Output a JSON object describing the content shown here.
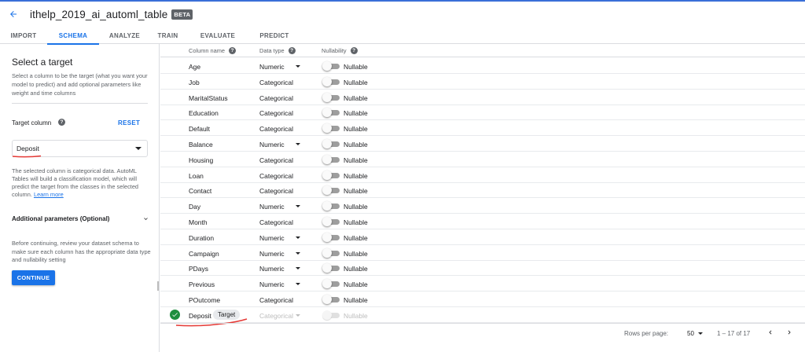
{
  "header": {
    "title": "ithelp_2019_ai_automl_table",
    "badge": "BETA"
  },
  "tabs": [
    "IMPORT",
    "SCHEMA",
    "ANALYZE",
    "TRAIN",
    "EVALUATE",
    "PREDICT"
  ],
  "active_tab": "SCHEMA",
  "sidebar": {
    "title": "Select a target",
    "description": "Select a column to be the target (what you want your model to predict) and add optional parameters like weight and time columns",
    "target_label": "Target column",
    "reset_label": "RESET",
    "target_value": "Deposit",
    "info_text": "The selected column is categorical data. AutoML Tables will build a classification model, which will predict the target from the classes in the selected column.",
    "learn_more": "Learn more",
    "additional_label": "Additional parameters (Optional)",
    "note": "Before continuing, review your dataset schema to make sure each column has the appropriate data type and nullability setting",
    "continue_label": "CONTINUE"
  },
  "table": {
    "headers": {
      "name": "Column name",
      "type": "Data type",
      "nullability": "Nullability"
    },
    "rows": [
      {
        "name": "Age",
        "type": "Numeric",
        "nullable": "Nullable",
        "dropdown": true
      },
      {
        "name": "Job",
        "type": "Categorical",
        "nullable": "Nullable",
        "dropdown": false
      },
      {
        "name": "MaritalStatus",
        "type": "Categorical",
        "nullable": "Nullable",
        "dropdown": false
      },
      {
        "name": "Education",
        "type": "Categorical",
        "nullable": "Nullable",
        "dropdown": false
      },
      {
        "name": "Default",
        "type": "Categorical",
        "nullable": "Nullable",
        "dropdown": false
      },
      {
        "name": "Balance",
        "type": "Numeric",
        "nullable": "Nullable",
        "dropdown": true
      },
      {
        "name": "Housing",
        "type": "Categorical",
        "nullable": "Nullable",
        "dropdown": false
      },
      {
        "name": "Loan",
        "type": "Categorical",
        "nullable": "Nullable",
        "dropdown": false
      },
      {
        "name": "Contact",
        "type": "Categorical",
        "nullable": "Nullable",
        "dropdown": false
      },
      {
        "name": "Day",
        "type": "Numeric",
        "nullable": "Nullable",
        "dropdown": true
      },
      {
        "name": "Month",
        "type": "Categorical",
        "nullable": "Nullable",
        "dropdown": false
      },
      {
        "name": "Duration",
        "type": "Numeric",
        "nullable": "Nullable",
        "dropdown": true
      },
      {
        "name": "Campaign",
        "type": "Numeric",
        "nullable": "Nullable",
        "dropdown": true
      },
      {
        "name": "PDays",
        "type": "Numeric",
        "nullable": "Nullable",
        "dropdown": true
      },
      {
        "name": "Previous",
        "type": "Numeric",
        "nullable": "Nullable",
        "dropdown": true
      },
      {
        "name": "POutcome",
        "type": "Categorical",
        "nullable": "Nullable",
        "dropdown": false
      },
      {
        "name": "Deposit",
        "type": "Categorical",
        "nullable": "Nullable",
        "dropdown": true,
        "target": true,
        "target_chip": "Target"
      }
    ]
  },
  "footer": {
    "rows_per_page_label": "Rows per page:",
    "rows_per_page": "50",
    "range": "1 – 17 of 17"
  },
  "colors": {
    "accent": "#1a73e8",
    "success": "#1e8e3e",
    "annotation_red": "#e53935"
  },
  "icons": [
    "arrow-back-icon",
    "help-icon",
    "dropdown-icon",
    "chevron-down-icon",
    "check-circle-icon",
    "chevron-left-icon",
    "chevron-right-icon"
  ]
}
